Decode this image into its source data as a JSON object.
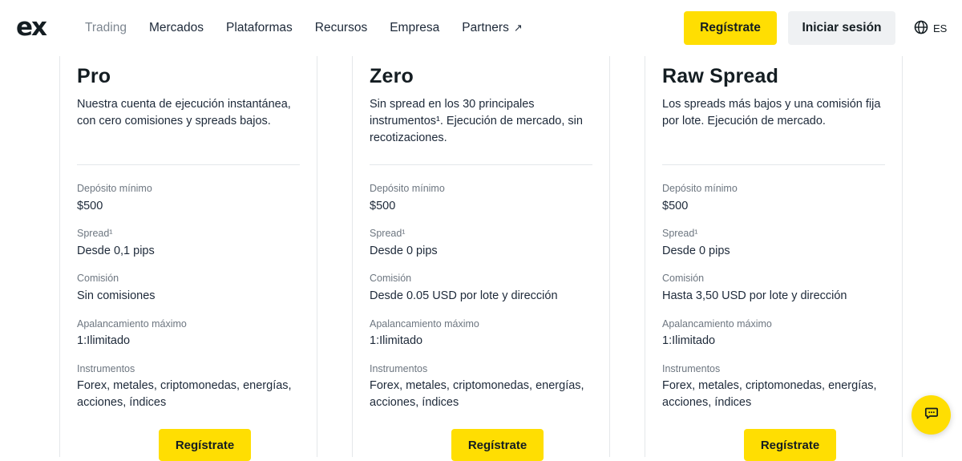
{
  "header": {
    "logo": "ex",
    "nav": [
      {
        "label": "Trading"
      },
      {
        "label": "Mercados"
      },
      {
        "label": "Plataformas"
      },
      {
        "label": "Recursos"
      },
      {
        "label": "Empresa"
      },
      {
        "label": "Partners",
        "arrow": "↗"
      }
    ],
    "register_label": "Regístrate",
    "login_label": "Iniciar sesión",
    "language": "ES"
  },
  "cards": [
    {
      "title": "Pro",
      "description": "Nuestra cuenta de ejecución instantánea, con cero comisiones y spreads bajos.",
      "rows": [
        {
          "label": "Depósito mínimo",
          "value": "$500"
        },
        {
          "label": "Spread¹",
          "value": "Desde 0,1 pips"
        },
        {
          "label": "Comisión",
          "value": "Sin comisiones"
        },
        {
          "label": "Apalancamiento máximo",
          "value": "1:Ilimitado"
        },
        {
          "label": "Instrumentos",
          "value": "Forex, metales, criptomonedas, energías, acciones, índices"
        }
      ],
      "button_label": "Regístrate"
    },
    {
      "title": "Zero",
      "description": "Sin spread en los 30 principales instrumentos¹. Ejecución de mercado, sin recotizaciones.",
      "rows": [
        {
          "label": "Depósito mínimo",
          "value": "$500"
        },
        {
          "label": "Spread¹",
          "value": "Desde 0 pips"
        },
        {
          "label": "Comisión",
          "value": "Desde 0.05 USD por lote y dirección"
        },
        {
          "label": "Apalancamiento máximo",
          "value": "1:Ilimitado"
        },
        {
          "label": "Instrumentos",
          "value": "Forex, metales, criptomonedas, energías, acciones, índices"
        }
      ],
      "button_label": "Regístrate"
    },
    {
      "title": "Raw Spread",
      "description": "Los spreads más bajos y una comisión fija por lote. Ejecución de mercado.",
      "rows": [
        {
          "label": "Depósito mínimo",
          "value": "$500"
        },
        {
          "label": "Spread¹",
          "value": "Desde 0 pips"
        },
        {
          "label": "Comisión",
          "value": "Hasta 3,50 USD por lote y dirección"
        },
        {
          "label": "Apalancamiento máximo",
          "value": "1:Ilimitado"
        },
        {
          "label": "Instrumentos",
          "value": "Forex, metales, criptomonedas, energías, acciones, índices"
        }
      ],
      "button_label": "Regístrate"
    }
  ],
  "icons": {
    "globe": "globe-icon",
    "chat": "chat-icon"
  },
  "colors": {
    "accent": "#ffde02",
    "text": "#1d2939",
    "muted": "#7d8690",
    "login_bg": "#eff1f3"
  }
}
